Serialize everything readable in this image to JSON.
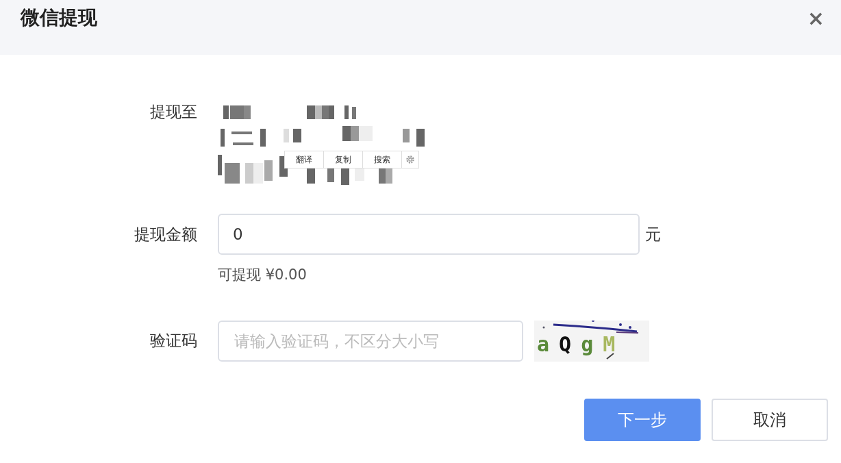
{
  "dialog": {
    "title": "微信提现",
    "close": "×"
  },
  "withdraw_to": {
    "label": "提现至"
  },
  "selection_toolbar": {
    "buttons": [
      "翻译",
      "复制",
      "搜索"
    ]
  },
  "amount": {
    "label": "提现金额",
    "value": "0",
    "unit": "元",
    "available": "可提现 ¥0.00"
  },
  "captcha": {
    "label": "验证码",
    "placeholder": "请输入验证码，不区分大小写",
    "characters": [
      {
        "text": "a",
        "color": "#5a8a3a"
      },
      {
        "text": "Q",
        "color": "#111111"
      },
      {
        "text": "g",
        "color": "#5a8a3a"
      },
      {
        "text": "M",
        "color": "#a8b860"
      }
    ]
  },
  "buttons": [
    {
      "label": "下一步",
      "kind": "primary"
    },
    {
      "label": "取消",
      "kind": "secondary"
    }
  ]
}
